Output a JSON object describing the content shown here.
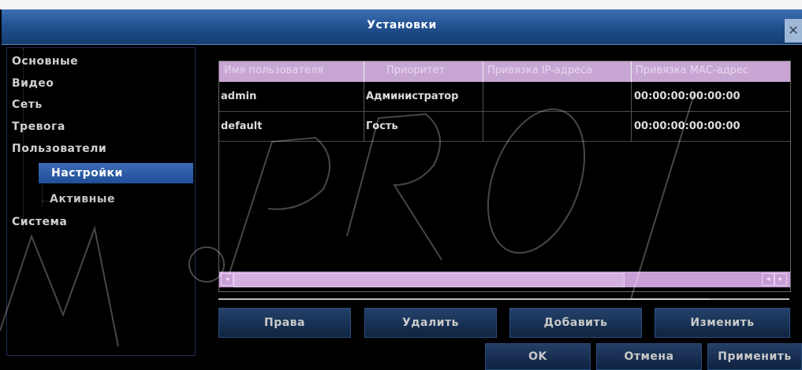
{
  "window": {
    "title": "Установки",
    "close_icon": "close-icon"
  },
  "sidebar": {
    "items": [
      {
        "label": "Основные"
      },
      {
        "label": "Видео"
      },
      {
        "label": "Сеть"
      },
      {
        "label": "Тревога"
      },
      {
        "label": "Пользователи"
      },
      {
        "label": "Настройки",
        "selected": true
      },
      {
        "label": "Активные"
      },
      {
        "label": "Система"
      }
    ]
  },
  "table": {
    "columns": [
      "Имя пользователя",
      "Приоритет",
      "Привязка IP-адреса",
      "Привязка МАС-адрес"
    ],
    "rows": [
      [
        "admin",
        "Администратор",
        "",
        "00:00:00:00:00:00"
      ],
      [
        "default",
        "Гость",
        "",
        "00:00:00:00:00:00"
      ]
    ]
  },
  "actions": {
    "rights": "Права",
    "delete": "Удалить",
    "add": "Добавить",
    "edit": "Изменить"
  },
  "footer": {
    "ok": "OK",
    "cancel": "Отмена",
    "apply": "Применить"
  },
  "colors": {
    "title_bar": "#20508f",
    "table_header": "#c8a6d4",
    "selection": "#2f5ea8"
  }
}
